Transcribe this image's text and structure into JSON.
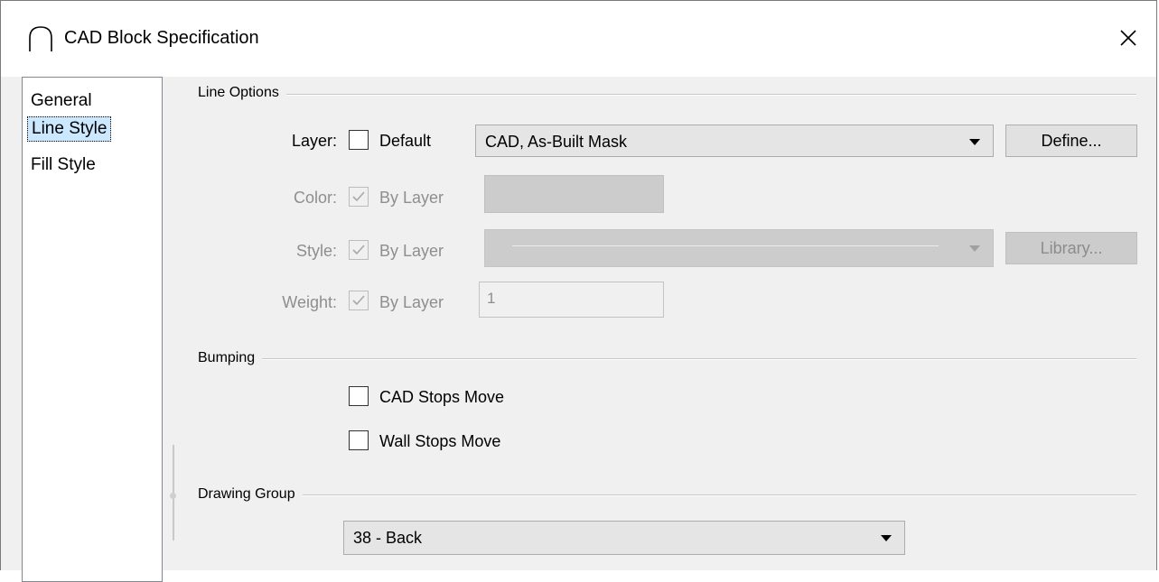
{
  "window": {
    "title": "CAD Block Specification",
    "icon": "arc-icon",
    "close_icon": "close-icon"
  },
  "sidebar": {
    "items": [
      {
        "label": "General",
        "selected": false
      },
      {
        "label": "Line Style",
        "selected": true
      },
      {
        "label": "Fill Style",
        "selected": false
      }
    ]
  },
  "line_options": {
    "heading": "Line Options",
    "layer": {
      "label": "Layer:",
      "default_checkbox_label": "Default",
      "default_checked": false,
      "select_value": "CAD, As-Built Mask",
      "define_button": "Define..."
    },
    "color": {
      "label": "Color:",
      "by_layer_label": "By Layer",
      "by_layer_checked": true
    },
    "style": {
      "label": "Style:",
      "by_layer_label": "By Layer",
      "by_layer_checked": true,
      "library_button": "Library..."
    },
    "weight": {
      "label": "Weight:",
      "by_layer_label": "By Layer",
      "by_layer_checked": true,
      "value": "1"
    }
  },
  "bumping": {
    "heading": "Bumping",
    "cad_stops_move": {
      "label": "CAD Stops Move",
      "checked": false
    },
    "wall_stops_move": {
      "label": "Wall Stops Move",
      "checked": false
    }
  },
  "drawing_group": {
    "heading": "Drawing Group",
    "select_value": "38 - Back"
  }
}
